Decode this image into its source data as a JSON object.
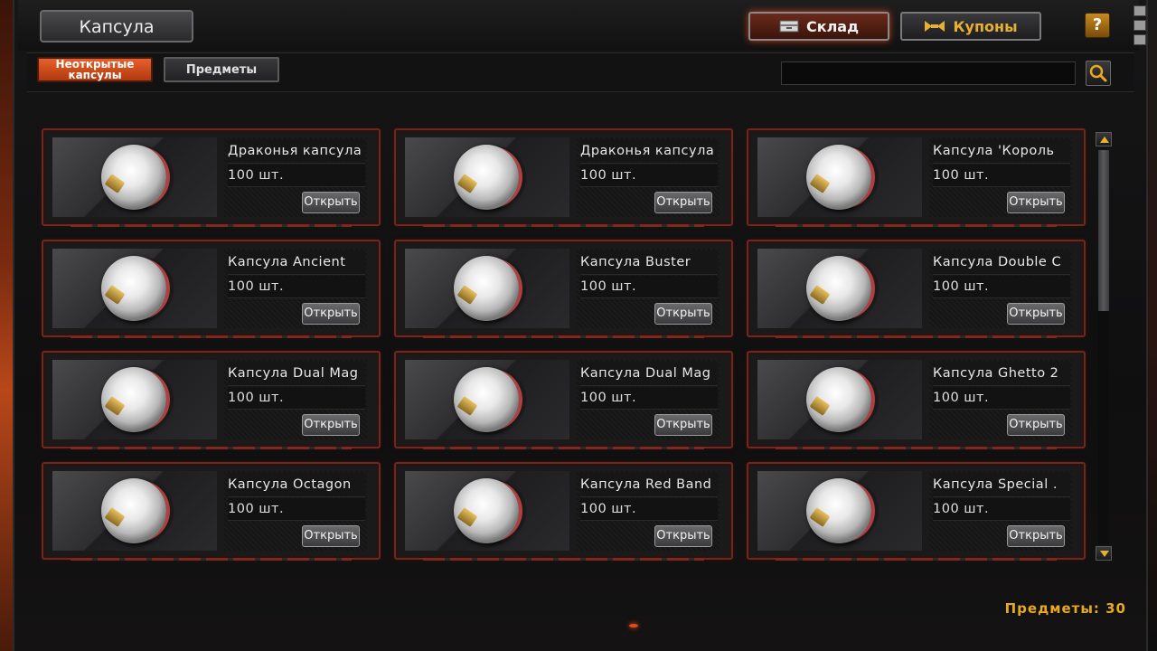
{
  "window": {
    "title": "Капсула"
  },
  "header": {
    "warehouse_label": "Склад",
    "coupons_label": "Купоны",
    "help_label": "?"
  },
  "tabs": [
    {
      "label": "Неоткрытые\nкапсулы",
      "active": true
    },
    {
      "label": "Предметы",
      "active": false
    }
  ],
  "search": {
    "value": "",
    "placeholder": ""
  },
  "items": [
    {
      "name": "Драконья капсула",
      "qty": "100 шт.",
      "button": "Открыть"
    },
    {
      "name": "Драконья капсула",
      "qty": "100 шт.",
      "button": "Открыть"
    },
    {
      "name": "Капсула 'Король",
      "qty": "100 шт.",
      "button": "Открыть"
    },
    {
      "name": "Капсула Ancient",
      "qty": "100 шт.",
      "button": "Открыть"
    },
    {
      "name": "Капсула Buster",
      "qty": "100 шт.",
      "button": "Открыть"
    },
    {
      "name": "Капсула Double C",
      "qty": "100 шт.",
      "button": "Открыть"
    },
    {
      "name": "Капсула Dual Mag",
      "qty": "100 шт.",
      "button": "Открыть"
    },
    {
      "name": "Капсула Dual Mag",
      "qty": "100 шт.",
      "button": "Открыть"
    },
    {
      "name": "Капсула Ghetto 2",
      "qty": "100 шт.",
      "button": "Открыть"
    },
    {
      "name": "Капсула Octagon",
      "qty": "100 шт.",
      "button": "Открыть"
    },
    {
      "name": "Капсула Red Band",
      "qty": "100 шт.",
      "button": "Открыть"
    },
    {
      "name": "Капсула Special .",
      "qty": "100 шт.",
      "button": "Открыть"
    }
  ],
  "footer": {
    "items_count_label": "Предметы: 30"
  },
  "colors": {
    "accent": "#e8602a",
    "gold": "#e8a820",
    "card_border": "#6a2a22"
  },
  "icons": {
    "warehouse": "warehouse-icon",
    "coupons": "coupon-icon",
    "search": "search-icon",
    "capsule": "capsule-icon"
  }
}
